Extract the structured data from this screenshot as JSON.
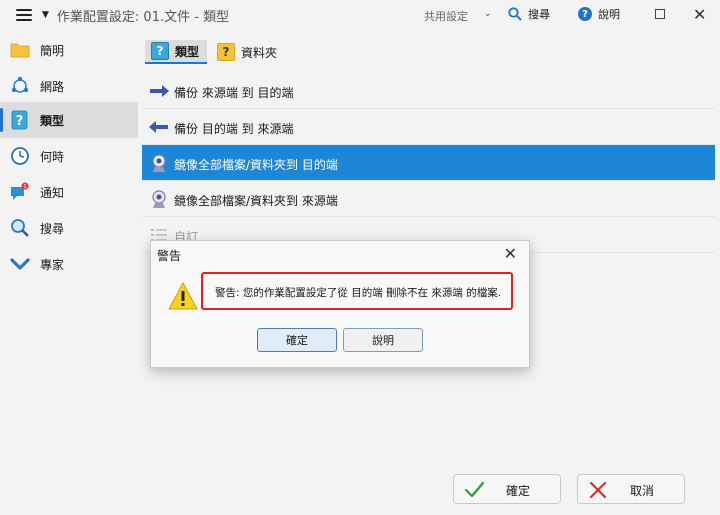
{
  "title_bar": {
    "title": "作業配置設定: 01.文件 - 類型",
    "shared_settings": "共用設定",
    "search_label": "搜尋",
    "help_label": "說明"
  },
  "sidebar": {
    "items": [
      {
        "label": "簡明",
        "icon": "folder-icon"
      },
      {
        "label": "網路",
        "icon": "network-icon"
      },
      {
        "label": "類型",
        "icon": "question-icon"
      },
      {
        "label": "何時",
        "icon": "clock-icon"
      },
      {
        "label": "通知",
        "icon": "notification-icon"
      },
      {
        "label": "搜尋",
        "icon": "search-icon"
      },
      {
        "label": "專家",
        "icon": "chevron-down-icon"
      }
    ],
    "active_index": 2
  },
  "tabs": [
    {
      "label": "類型",
      "icon": "question-icon"
    },
    {
      "label": "資料夾",
      "icon": "folder-question-icon"
    }
  ],
  "backup_types": [
    {
      "label": "備份 來源端 到 目的端",
      "icon": "arrow-right-icon"
    },
    {
      "label": "備份 目的端 到 來源端",
      "icon": "arrow-left-icon"
    },
    {
      "label": "鏡像全部檔案/資料夾到 目的端",
      "icon": "mirror-icon"
    },
    {
      "label": "鏡像全部檔案/資料夾到 來源端",
      "icon": "mirror-icon"
    },
    {
      "label": "自訂",
      "icon": "list-icon"
    }
  ],
  "selected_type_index": 2,
  "dialog": {
    "title": "警告",
    "message": "警告: 您的作業配置設定了從 目的端 刪除不在 來源端 的檔案.",
    "ok_label": "確定",
    "help_label": "說明"
  },
  "footer": {
    "ok_label": "確定",
    "cancel_label": "取消"
  },
  "colors": {
    "accent": "#1e73d2",
    "selection": "#1e86d6",
    "warning_border": "#e02020"
  }
}
